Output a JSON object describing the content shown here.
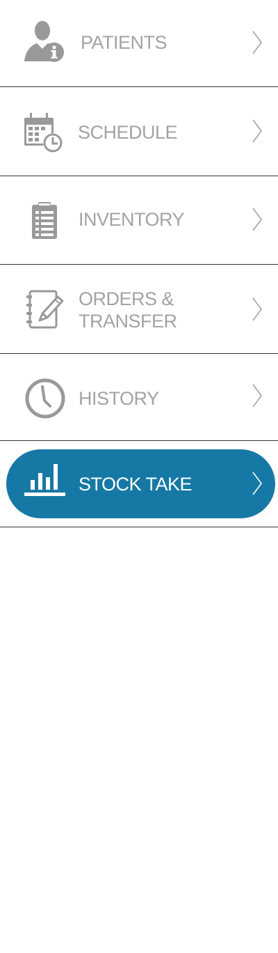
{
  "menu": {
    "items": [
      {
        "label": "PATIENTS",
        "icon": "patient-info-icon",
        "active": false
      },
      {
        "label": "SCHEDULE",
        "icon": "calendar-clock-icon",
        "active": false
      },
      {
        "label": "INVENTORY",
        "icon": "clipboard-list-icon",
        "active": false
      },
      {
        "label_line1": "ORDERS &",
        "label_line2": "TRANSFER",
        "icon": "notebook-pencil-icon",
        "active": false
      },
      {
        "label": "HISTORY",
        "icon": "clock-icon",
        "active": false
      },
      {
        "label": "STOCK TAKE",
        "icon": "bar-chart-icon",
        "active": true
      }
    ]
  },
  "colors": {
    "inactive_text": "#a3a3a3",
    "inactive_icon": "#999999",
    "active_background": "#1679a5",
    "active_text": "#ffffff",
    "divider": "#333333"
  }
}
